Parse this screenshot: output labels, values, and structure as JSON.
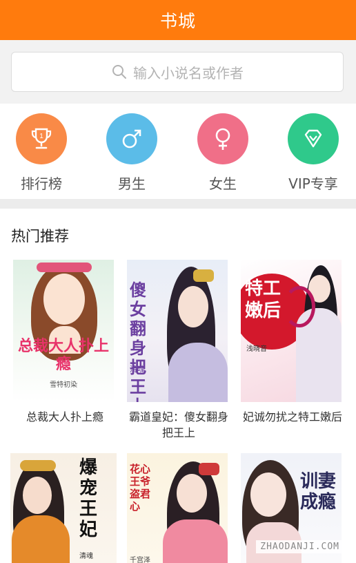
{
  "header": {
    "title": "书城"
  },
  "search": {
    "placeholder": "输入小说名或作者"
  },
  "categories": [
    {
      "label": "排行榜",
      "icon": "trophy-icon",
      "color": "#f98a47"
    },
    {
      "label": "男生",
      "icon": "male-icon",
      "color": "#5bbce8"
    },
    {
      "label": "女生",
      "icon": "female-icon",
      "color": "#f06f88"
    },
    {
      "label": "VIP专享",
      "icon": "diamond-icon",
      "color": "#2fc98b"
    }
  ],
  "section": {
    "title": "热门推荐"
  },
  "books": [
    {
      "title": "总裁大人扑上瘾",
      "cover_text": "总裁大人扑上瘾",
      "author": "雪特初染"
    },
    {
      "title": "霸道皇妃：傻女翻身把王上",
      "cover_text": "傻女翻身把王上",
      "author": "清魂"
    },
    {
      "title": "妃诚勿扰之特工嫩后",
      "cover_text": "特工嫩后",
      "author": "浅晓音"
    },
    {
      "title": "",
      "cover_text": "爆宠王妃",
      "author": "清魂"
    },
    {
      "title": "",
      "cover_text": "花心王爷 盗君心",
      "author": "千宫泽"
    },
    {
      "title": "",
      "cover_text": "训妻成瘾",
      "author": ""
    }
  ],
  "watermark": "ZHAODANJI.COM"
}
